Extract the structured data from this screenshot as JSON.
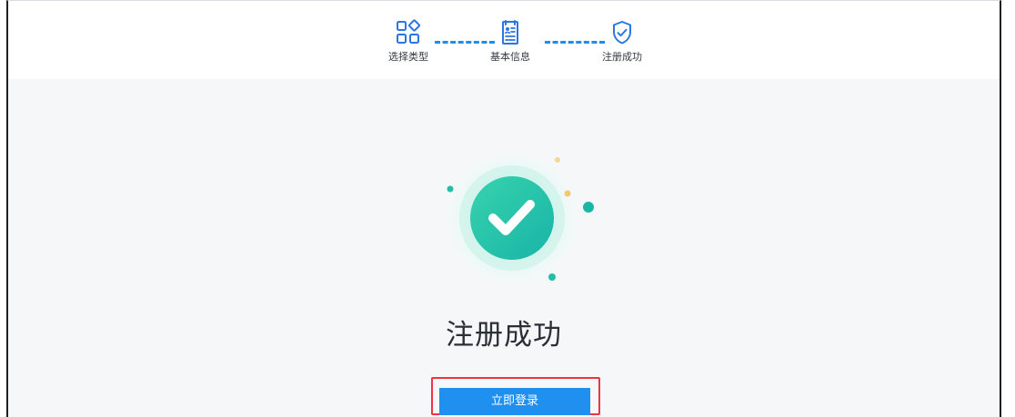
{
  "steps": [
    {
      "label": "选择类型",
      "icon": "apps-grid-icon"
    },
    {
      "label": "基本信息",
      "icon": "id-card-icon"
    },
    {
      "label": "注册成功",
      "icon": "shield-check-icon"
    }
  ],
  "result": {
    "title": "注册成功",
    "status_icon": "check-circle-icon"
  },
  "actions": {
    "login_label": "立即登录"
  },
  "colors": {
    "accent": "#1f8ff0",
    "success": "#2bc4a6",
    "highlight": "#ef3340"
  }
}
